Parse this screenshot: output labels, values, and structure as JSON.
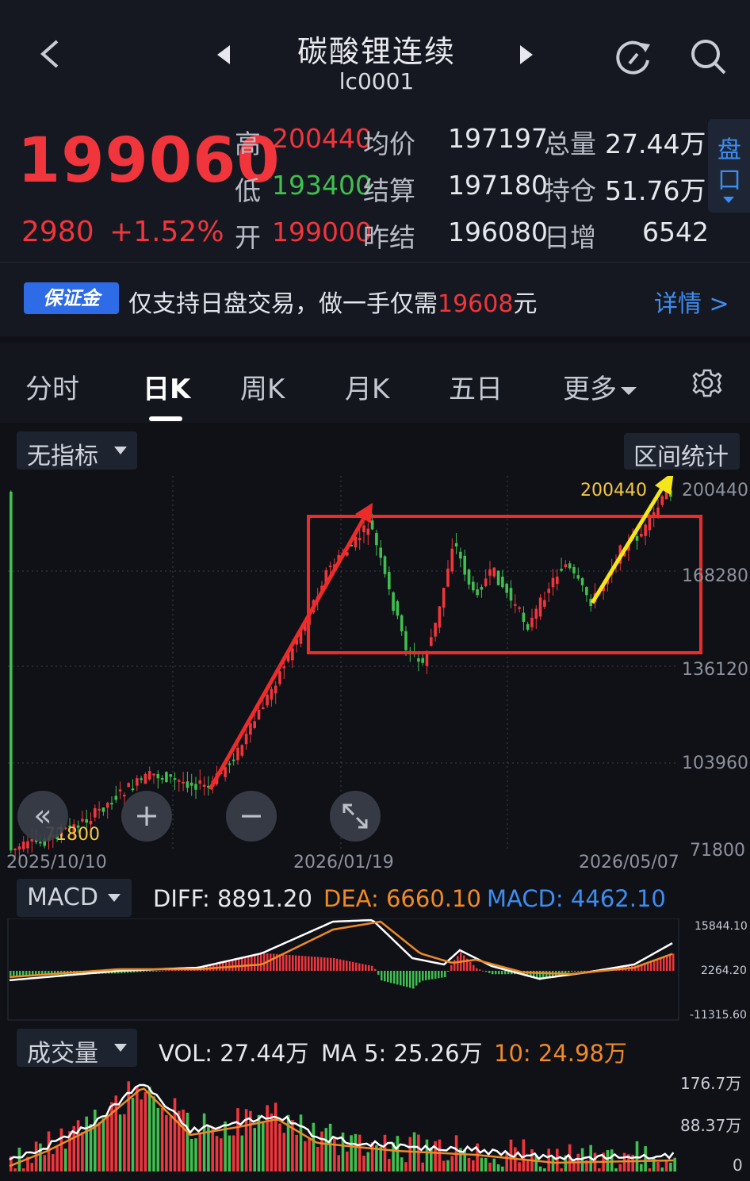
{
  "header": {
    "back_icon": "chevron-left-icon",
    "prev_icon": "triangle-left-icon",
    "next_icon": "triangle-right-icon",
    "title": "碳酸锂连续",
    "code": "lc0001",
    "refresh_icon": "refresh-icon",
    "search_icon": "search-icon"
  },
  "quote": {
    "price": "199060",
    "change": "2980",
    "change_pct": "+1.52%",
    "high_label": "高",
    "high": "200440",
    "low_label": "低",
    "low": "193400",
    "open_label": "开",
    "open": "199000",
    "avg_label": "均价",
    "avg": "197197",
    "settle_label": "结算",
    "settle": "197180",
    "prev_settle_label": "昨结",
    "prev_settle": "196080",
    "volume_label": "总量",
    "volume": "27.44万",
    "oi_label": "持仓",
    "oi": "51.76万",
    "daily_inc_label": "日增",
    "daily_inc": "6542",
    "side_btn_line1": "盘",
    "side_btn_line2": "口"
  },
  "banner": {
    "tag": "保证金",
    "text_before": "仅支持日盘交易，做一手仅需",
    "amount": "19608",
    "text_after": "元",
    "detail": "详情 >"
  },
  "tabs": [
    "分时",
    "日K",
    "周K",
    "月K",
    "五日",
    "更多"
  ],
  "active_tab": 1,
  "chart": {
    "indicator_dropdown": "无指标",
    "range_button": "区间统计",
    "y_ticks": [
      "200440",
      "168280",
      "136120",
      "103960",
      "71800"
    ],
    "x_ticks": [
      "2025/10/10",
      "2026/01/19",
      "2026/05/07"
    ],
    "high_marker": "200440",
    "low_marker": "71800"
  },
  "macd": {
    "dropdown": "MACD",
    "diff": "DIFF: 8891.20",
    "dea": "DEA: 6660.10",
    "macd": "MACD: 4462.10",
    "y_ticks": [
      "15844.10",
      "2264.20",
      "-11315.60"
    ]
  },
  "volume": {
    "dropdown": "成交量",
    "vol": "VOL: 27.44万",
    "ma5": "MA 5: 25.26万",
    "ma10": "10: 24.98万",
    "y_ticks": [
      "176.7万",
      "88.37万",
      "0"
    ]
  },
  "colors": {
    "up": "#f0353c",
    "down": "#3fbf4f",
    "accent": "#2e6be6",
    "dea": "#f08a24",
    "macd": "#3d8df0",
    "arrow": "#f5e61a"
  }
}
